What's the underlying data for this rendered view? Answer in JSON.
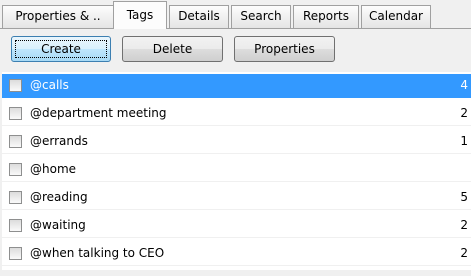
{
  "tabs": [
    {
      "label": "Properties & .."
    },
    {
      "label": "Tags",
      "active": true
    },
    {
      "label": "Details"
    },
    {
      "label": "Search"
    },
    {
      "label": "Reports"
    },
    {
      "label": "Calendar"
    }
  ],
  "toolbar": {
    "create_label": "Create",
    "delete_label": "Delete",
    "properties_label": "Properties"
  },
  "tags": [
    {
      "name": "@calls",
      "count": "4",
      "selected": true,
      "checked": false
    },
    {
      "name": "@department meeting",
      "count": "2",
      "checked": false
    },
    {
      "name": "@errands",
      "count": "1",
      "checked": false
    },
    {
      "name": "@home",
      "count": "",
      "checked": false
    },
    {
      "name": "@reading",
      "count": "5",
      "checked": false
    },
    {
      "name": "@waiting",
      "count": "2",
      "checked": false
    },
    {
      "name": "@when talking to CEO",
      "count": "2",
      "checked": false
    }
  ],
  "colors": {
    "selection": "#3399ff",
    "window_bg": "#f0f0f0",
    "default_button_border": "#3c7fb1"
  }
}
